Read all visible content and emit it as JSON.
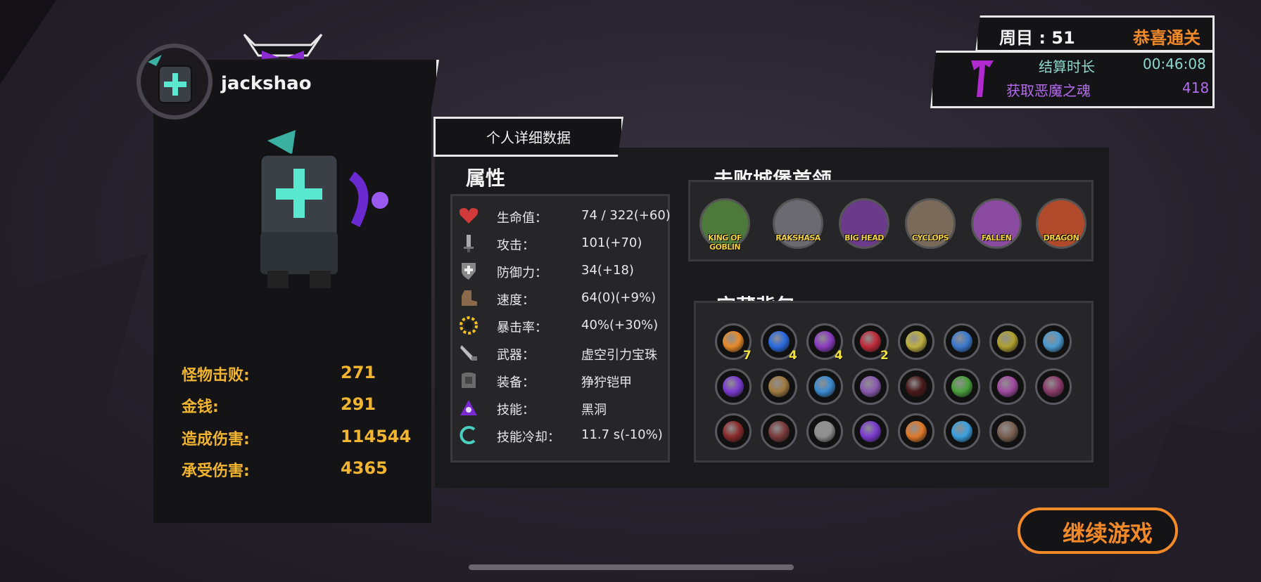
{
  "player": {
    "name": "jackshao"
  },
  "summary_stats": [
    {
      "label": "怪物击败:",
      "value": "271"
    },
    {
      "label": "金钱:",
      "value": "291"
    },
    {
      "label": "造成伤害:",
      "value": "114544"
    },
    {
      "label": "承受伤害:",
      "value": "4365"
    }
  ],
  "detail_tab": {
    "label": "个人详细数据"
  },
  "attributes": {
    "title": "属性",
    "rows": [
      {
        "icon": "heart-icon",
        "label": "生命值：",
        "value": "74 / 322(+60)"
      },
      {
        "icon": "sword-icon",
        "label": "攻击：",
        "value": "101(+70)"
      },
      {
        "icon": "shield-icon",
        "label": "防御力：",
        "value": "34(+18)"
      },
      {
        "icon": "boot-icon",
        "label": "速度：",
        "value": "64(0)(+9%)"
      },
      {
        "icon": "sun-icon",
        "label": "暴击率：",
        "value": "40%(+30%)"
      },
      {
        "icon": "weapon-icon",
        "label": "武器：",
        "value": "虚空引力宝珠"
      },
      {
        "icon": "armor-icon",
        "label": "装备：",
        "value": "狰狞铠甲"
      },
      {
        "icon": "skill-icon",
        "label": "技能：",
        "value": "黑洞"
      },
      {
        "icon": "cooldown-icon",
        "label": "技能冷却：",
        "value": "11.7 s(-10%)"
      }
    ]
  },
  "bosses": {
    "title": "击败城堡首领",
    "items": [
      {
        "name": "KING OF GOBLIN",
        "color": "#4d7a3a"
      },
      {
        "name": "RAKSHASA",
        "color": "#6a6a70"
      },
      {
        "name": "BIG HEAD",
        "color": "#6b3a8a"
      },
      {
        "name": "CYCLOPS",
        "color": "#7a6a5a"
      },
      {
        "name": "FALLEN",
        "color": "#8a4aa0"
      },
      {
        "name": "DRAGON",
        "color": "#b04a2a"
      }
    ]
  },
  "treasure": {
    "title": "宝藏背包",
    "items": [
      {
        "icon": "fire-crystal-icon",
        "color": "#e88a2a",
        "count": "7"
      },
      {
        "icon": "blue-crystal-icon",
        "color": "#2a6ae0",
        "count": "4"
      },
      {
        "icon": "purple-crystal-icon",
        "color": "#8a3ac0",
        "count": "4"
      },
      {
        "icon": "red-gem-icon",
        "color": "#c02a3a",
        "count": "2"
      },
      {
        "icon": "gold-rune-icon",
        "color": "#c0b040",
        "count": ""
      },
      {
        "icon": "blue-potion-icon",
        "color": "#3a7ad0",
        "count": ""
      },
      {
        "icon": "gold-idol-icon",
        "color": "#b0a030",
        "count": ""
      },
      {
        "icon": "wing-boot-icon",
        "color": "#4a9ad0",
        "count": ""
      },
      {
        "icon": "purple-lightning-icon",
        "color": "#7a3ad0",
        "count": ""
      },
      {
        "icon": "backpack-icon",
        "color": "#a07a40",
        "count": ""
      },
      {
        "icon": "blue-eye-icon",
        "color": "#3a8ad0",
        "count": ""
      },
      {
        "icon": "purple-horn-icon",
        "color": "#8a5ab0",
        "count": ""
      },
      {
        "icon": "dark-orb-icon",
        "color": "#4a1a1a",
        "count": ""
      },
      {
        "icon": "green-potion-icon",
        "color": "#4aa03a",
        "count": ""
      },
      {
        "icon": "demon-mask-icon",
        "color": "#a04aa0",
        "count": ""
      },
      {
        "icon": "purple-claw-icon",
        "color": "#8a3a6a",
        "count": ""
      },
      {
        "icon": "red-skull-icon",
        "color": "#8a2a2a",
        "count": ""
      },
      {
        "icon": "brown-beast-icon",
        "color": "#7a3a3a",
        "count": ""
      },
      {
        "icon": "silver-helm-icon",
        "color": "#909090",
        "count": ""
      },
      {
        "icon": "purple-blade-icon",
        "color": "#7a3ad0",
        "count": ""
      },
      {
        "icon": "fire-swirl-icon",
        "color": "#e07a2a",
        "count": ""
      },
      {
        "icon": "ice-star-icon",
        "color": "#3aa0e0",
        "count": ""
      },
      {
        "icon": "stone-egg-icon",
        "color": "#7a6050",
        "count": ""
      }
    ]
  },
  "top_right": {
    "cycle": "周目 : 51",
    "clear": "恭喜通关",
    "time_label": "结算时长",
    "time_value": "00:46:08",
    "soul_label": "获取恶魔之魂",
    "soul_value": "418"
  },
  "continue_button": {
    "label": "继续游戏"
  },
  "colors": {
    "accent": "#f28a2a",
    "stat_gold": "#f2b532",
    "teal": "#8ed9cf",
    "purple": "#b56cf0"
  }
}
